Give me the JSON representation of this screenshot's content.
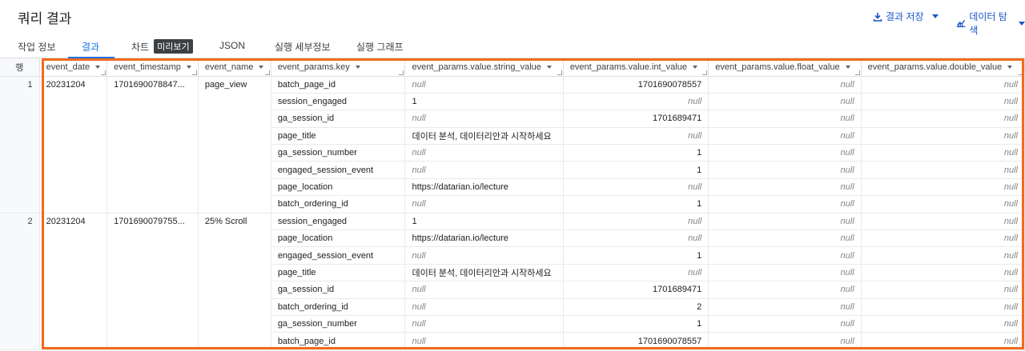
{
  "header": {
    "title": "쿼리 결과",
    "save_label": "결과 저장",
    "explore_label": "데이터 탐색"
  },
  "tabs": [
    {
      "label": "작업 정보"
    },
    {
      "label": "결과"
    },
    {
      "label": "차트",
      "badge": "미리보기"
    },
    {
      "label": "JSON"
    },
    {
      "label": "실행 세부정보"
    },
    {
      "label": "실행 그래프"
    }
  ],
  "columns": {
    "row": "행",
    "event_date": "event_date",
    "event_timestamp": "event_timestamp",
    "event_name": "event_name",
    "key": "event_params.key",
    "string_value": "event_params.value.string_value",
    "int_value": "event_params.value.int_value",
    "float_value": "event_params.value.float_value",
    "double_value": "event_params.value.double_value"
  },
  "null_text": "null",
  "rows": [
    {
      "row": "1",
      "event_date": "20231204",
      "event_timestamp": "1701690078847...",
      "event_name": "page_view",
      "params": [
        {
          "key": "batch_page_id",
          "string": null,
          "int": "1701690078557"
        },
        {
          "key": "session_engaged",
          "string": "1",
          "int": null
        },
        {
          "key": "ga_session_id",
          "string": null,
          "int": "1701689471"
        },
        {
          "key": "page_title",
          "string": "데이터 분석, 데이터리안과 시작하세요",
          "int": null
        },
        {
          "key": "ga_session_number",
          "string": null,
          "int": "1"
        },
        {
          "key": "engaged_session_event",
          "string": null,
          "int": "1"
        },
        {
          "key": "page_location",
          "string": "https://datarian.io/lecture",
          "int": null
        },
        {
          "key": "batch_ordering_id",
          "string": null,
          "int": "1"
        }
      ]
    },
    {
      "row": "2",
      "event_date": "20231204",
      "event_timestamp": "1701690079755...",
      "event_name": "25% Scroll",
      "params": [
        {
          "key": "session_engaged",
          "string": "1",
          "int": null
        },
        {
          "key": "page_location",
          "string": "https://datarian.io/lecture",
          "int": null
        },
        {
          "key": "engaged_session_event",
          "string": null,
          "int": "1"
        },
        {
          "key": "page_title",
          "string": "데이터 분석, 데이터리안과 시작하세요",
          "int": null
        },
        {
          "key": "ga_session_id",
          "string": null,
          "int": "1701689471"
        },
        {
          "key": "batch_ordering_id",
          "string": null,
          "int": "2"
        },
        {
          "key": "ga_session_number",
          "string": null,
          "int": "1"
        },
        {
          "key": "batch_page_id",
          "string": null,
          "int": "1701690078557"
        }
      ]
    }
  ],
  "colors": {
    "accent": "#1a73e8",
    "highlight_border": "#f26b1d"
  }
}
